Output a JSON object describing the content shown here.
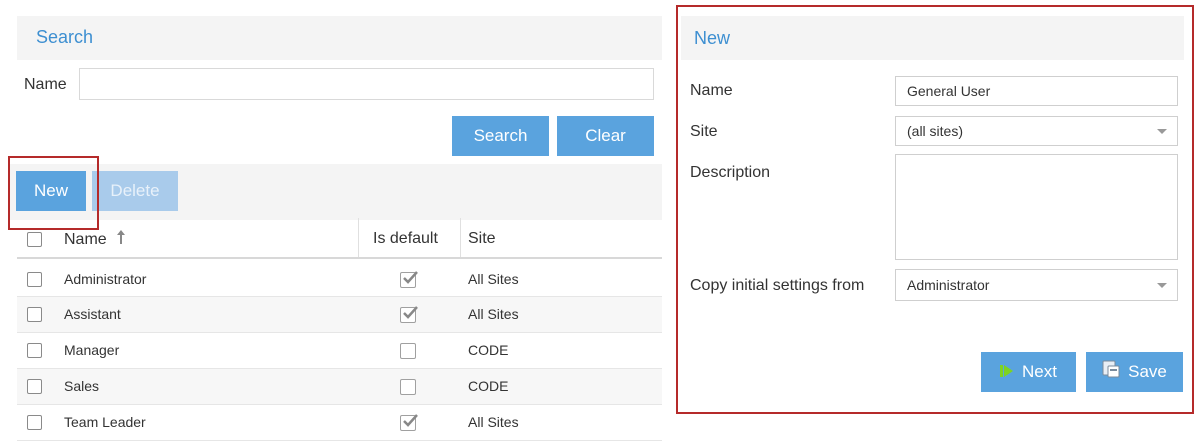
{
  "search": {
    "title": "Search",
    "name_label": "Name",
    "name_value": "",
    "search_label": "Search",
    "clear_label": "Clear"
  },
  "toolbar": {
    "new_label": "New",
    "delete_label": "Delete"
  },
  "table": {
    "headers": {
      "name": "Name",
      "sort_icon": "sort-ascending-icon",
      "is_default": "Is default",
      "site": "Site"
    },
    "rows": [
      {
        "name": "Administrator",
        "is_default": true,
        "site": "All Sites"
      },
      {
        "name": "Assistant",
        "is_default": true,
        "site": "All Sites"
      },
      {
        "name": "Manager",
        "is_default": false,
        "site": "CODE"
      },
      {
        "name": "Sales",
        "is_default": false,
        "site": "CODE"
      },
      {
        "name": "Team Leader",
        "is_default": true,
        "site": "All Sites"
      }
    ]
  },
  "new_form": {
    "title": "New",
    "name_label": "Name",
    "name_value": "General User",
    "site_label": "Site",
    "site_value": "(all sites)",
    "description_label": "Description",
    "description_value": "",
    "copy_label": "Copy initial settings from",
    "copy_value": "Administrator",
    "next_label": "Next",
    "next_icon": "next-icon",
    "save_label": "Save",
    "save_icon": "save-icon"
  },
  "colors": {
    "accent": "#5aa3de",
    "title": "#3d8fd1",
    "highlight": "#b52a2a"
  }
}
